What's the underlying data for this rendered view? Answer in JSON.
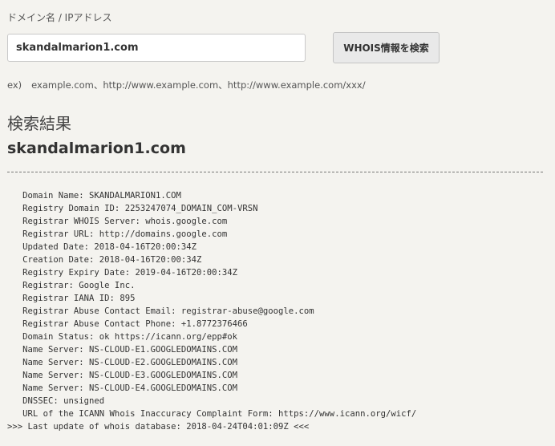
{
  "form": {
    "field_label": "ドメイン名 / IPアドレス",
    "input_value": "skandalmarion1.com",
    "search_button_label": "WHOIS情報を検索",
    "example_prefix": "ex)",
    "example_text": "example.com、http://www.example.com、http://www.example.com/xxx/"
  },
  "results": {
    "heading": "検索結果",
    "domain": "skandalmarion1.com",
    "whois_lines": [
      "   Domain Name: SKANDALMARION1.COM",
      "   Registry Domain ID: 2253247074_DOMAIN_COM-VRSN",
      "   Registrar WHOIS Server: whois.google.com",
      "   Registrar URL: http://domains.google.com",
      "   Updated Date: 2018-04-16T20:00:34Z",
      "   Creation Date: 2018-04-16T20:00:34Z",
      "   Registry Expiry Date: 2019-04-16T20:00:34Z",
      "   Registrar: Google Inc.",
      "   Registrar IANA ID: 895",
      "   Registrar Abuse Contact Email: registrar-abuse@google.com",
      "   Registrar Abuse Contact Phone: +1.8772376466",
      "   Domain Status: ok https://icann.org/epp#ok",
      "   Name Server: NS-CLOUD-E1.GOOGLEDOMAINS.COM",
      "   Name Server: NS-CLOUD-E2.GOOGLEDOMAINS.COM",
      "   Name Server: NS-CLOUD-E3.GOOGLEDOMAINS.COM",
      "   Name Server: NS-CLOUD-E4.GOOGLEDOMAINS.COM",
      "   DNSSEC: unsigned",
      "   URL of the ICANN Whois Inaccuracy Complaint Form: https://www.icann.org/wicf/",
      ">>> Last update of whois database: 2018-04-24T04:01:09Z <<<"
    ]
  }
}
